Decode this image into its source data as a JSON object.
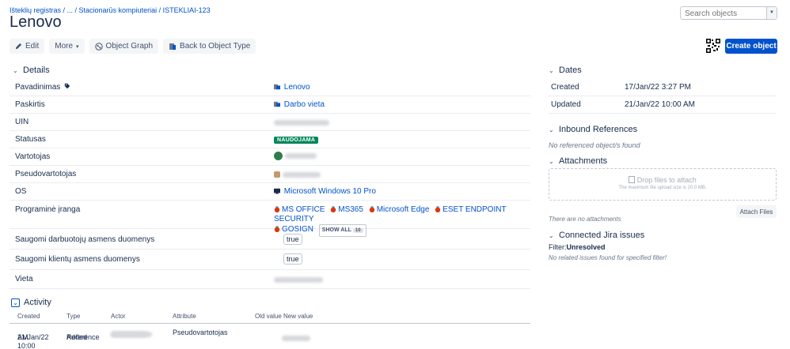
{
  "breadcrumb": {
    "text": "Išteklių registras / ... / Stacionarūs kompiuteriai / ISTEKLIAI-123"
  },
  "page_title": "Lenovo",
  "search": {
    "placeholder": "Search objects"
  },
  "toolbar": {
    "edit_label": "Edit",
    "more_label": "More",
    "graph_label": "Object Graph",
    "back_label": "Back to Object Type",
    "create_label": "Create object"
  },
  "details": {
    "title": "Details",
    "rows": {
      "pavadinimas": {
        "label": "Pavadinimas",
        "value": "Lenovo"
      },
      "paskirtis": {
        "label": "Paskirtis",
        "value": "Darbo vieta"
      },
      "uin": {
        "label": "UIN"
      },
      "statusas": {
        "label": "Statusas",
        "value": "NAUDOJAMA"
      },
      "vartotojas": {
        "label": "Vartotojas"
      },
      "pseudovartotojas": {
        "label": "Pseudovartotojas"
      },
      "os": {
        "label": "OS",
        "value": "Microsoft Windows 10 Pro"
      },
      "programine": {
        "label": "Programinė įranga",
        "items": [
          "MS OFFICE",
          "MS365",
          "Microsoft Edge",
          "ESET ENDPOINT SECURITY",
          "GOSIGN"
        ],
        "show_all": "SHOW ALL",
        "count": "10"
      },
      "darbuotoju": {
        "label": "Saugomi darbuotojų asmens duomenys",
        "value": "true"
      },
      "klientu": {
        "label": "Saugomi klientų asmens duomenys",
        "value": "true"
      },
      "vieta": {
        "label": "Vieta"
      }
    }
  },
  "activity": {
    "title": "Activity",
    "columns": [
      "Created",
      "Type",
      "Actor",
      "Attribute",
      "Old value",
      "New value"
    ],
    "rows": [
      {
        "created_line1": "21/Jan/22 10:00",
        "created_line2": "AM",
        "type_line1": "Added",
        "type_line2": "Reference",
        "attribute": "Pseudovartotojas"
      }
    ]
  },
  "dates": {
    "title": "Dates",
    "created_label": "Created",
    "created_value": "17/Jan/22 3:27 PM",
    "updated_label": "Updated",
    "updated_value": "21/Jan/22 10:00 AM"
  },
  "inbound": {
    "title": "Inbound References",
    "empty": "No referenced object/s found"
  },
  "attachments": {
    "title": "Attachments",
    "drop_text": "Drop files to attach",
    "limit_text": "The maximum file upload size is 20.0 MB.",
    "empty": "There are no attachments",
    "attach_label": "Attach Files"
  },
  "jira": {
    "title": "Connected Jira issues",
    "filter_label": "Filter:",
    "filter_value": "Unresolved",
    "empty": "No related issues found for specified filter!"
  },
  "colors": {
    "accent": "#0052cc",
    "status_green": "#00875a",
    "text": "#172b4d"
  },
  "icons": [
    "tag-icon",
    "pencil-icon",
    "chevron-down-icon",
    "graph-icon",
    "back-icon",
    "qr-code-icon",
    "object-icon",
    "monitor-icon",
    "software-icon",
    "file-icon"
  ]
}
